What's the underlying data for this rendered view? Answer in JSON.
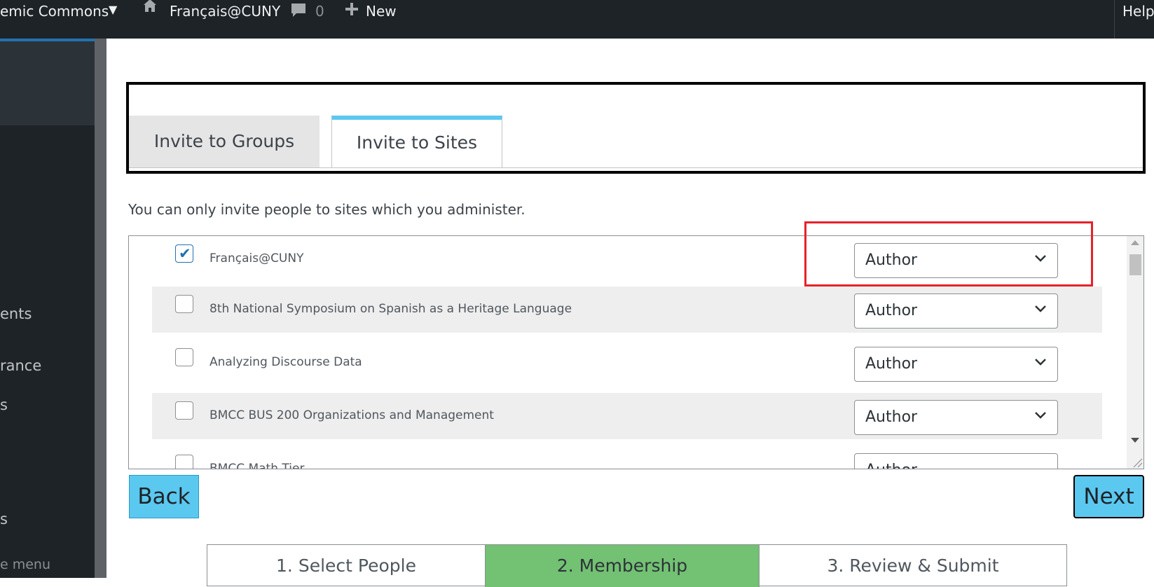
{
  "admin_bar": {
    "site_name": "emic Commons",
    "current_site": "Français@CUNY",
    "comments_count": "0",
    "new_label": "New",
    "help_label": "Help"
  },
  "sidebar": {
    "items": [
      {
        "label": "ents"
      },
      {
        "label": "rance"
      },
      {
        "label": "s"
      },
      {
        "label": "s"
      }
    ],
    "collapse_label": "e menu"
  },
  "tabs": [
    {
      "label": "Invite to Groups",
      "active": false
    },
    {
      "label": "Invite to Sites",
      "active": true
    }
  ],
  "notice": "You can only invite people to sites which you administer.",
  "sites": [
    {
      "name": "Français@CUNY",
      "checked": true,
      "role": "Author"
    },
    {
      "name": "8th National Symposium on Spanish as a Heritage Language",
      "checked": false,
      "role": "Author"
    },
    {
      "name": "Analyzing Discourse Data",
      "checked": false,
      "role": "Author"
    },
    {
      "name": "BMCC BUS 200 Organizations and Management",
      "checked": false,
      "role": "Author"
    },
    {
      "name": "BMCC Math Tier...",
      "checked": false,
      "role": "Author"
    }
  ],
  "buttons": {
    "back": "Back",
    "next": "Next"
  },
  "steps": [
    {
      "label": "1. Select People",
      "active": false
    },
    {
      "label": "2. Membership",
      "active": true
    },
    {
      "label": "3. Review & Submit",
      "active": false
    }
  ],
  "colors": {
    "admin_bar_bg": "#1d2327",
    "accent_blue": "#5bc8f0",
    "step_active": "#73c173",
    "highlight_red": "#e8212a"
  }
}
